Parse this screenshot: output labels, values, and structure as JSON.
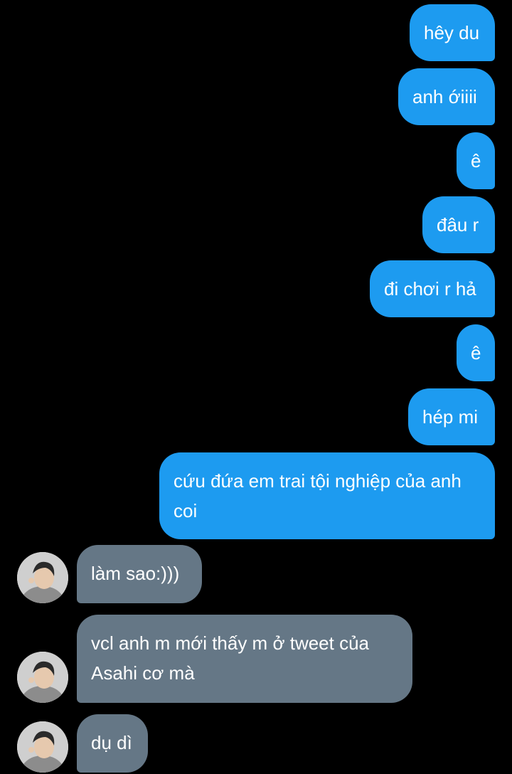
{
  "colors": {
    "background": "#000000",
    "outgoing_bubble": "#1d9bf0",
    "incoming_bubble": "#657786",
    "text": "#ffffff"
  },
  "conversation": {
    "outgoing": [
      {
        "text": "hêy du"
      },
      {
        "text": "anh ớiiii"
      },
      {
        "text": "ê"
      },
      {
        "text": "đâu r"
      },
      {
        "text": "đi chơi r hả"
      },
      {
        "text": "ê"
      },
      {
        "text": "hép mi"
      },
      {
        "text": "cứu đứa em trai tội nghiệp của anh coi"
      }
    ],
    "incoming": [
      {
        "text": "làm sao:)))",
        "avatar": "contact-avatar"
      },
      {
        "text": "vcl anh m mới thấy m ở tweet của Asahi cơ mà",
        "avatar": "contact-avatar"
      },
      {
        "text": "dụ dì",
        "avatar": "contact-avatar"
      }
    ]
  }
}
